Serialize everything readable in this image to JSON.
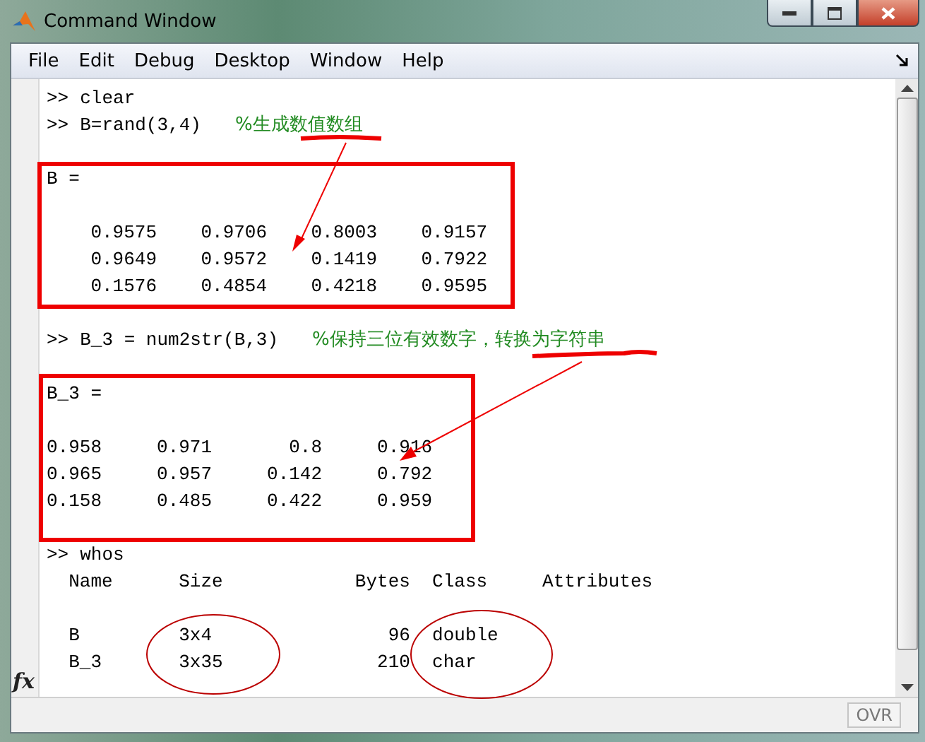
{
  "window": {
    "title": "Command Window"
  },
  "menu": [
    "File",
    "Edit",
    "Debug",
    "Desktop",
    "Window",
    "Help"
  ],
  "console": [
    {
      "kind": "command",
      "prompt": ">>",
      "command": "clear"
    },
    {
      "kind": "command",
      "prompt": ">>",
      "command": "B=rand(3,4)",
      "comment": "%生成数值数组"
    },
    {
      "kind": "blank"
    },
    {
      "kind": "output",
      "text": "B ="
    },
    {
      "kind": "blank"
    },
    {
      "kind": "output",
      "text": "    0.9575    0.9706    0.8003    0.9157"
    },
    {
      "kind": "output",
      "text": "    0.9649    0.9572    0.1419    0.7922"
    },
    {
      "kind": "output",
      "text": "    0.1576    0.4854    0.4218    0.9595"
    },
    {
      "kind": "blank"
    },
    {
      "kind": "command",
      "prompt": ">>",
      "command": "B_3 = num2str(B,3)",
      "comment": "%保持三位有效数字，转换为字符串"
    },
    {
      "kind": "blank"
    },
    {
      "kind": "output",
      "text": "B_3 ="
    },
    {
      "kind": "blank"
    },
    {
      "kind": "output",
      "text": "0.958     0.971       0.8     0.916"
    },
    {
      "kind": "output",
      "text": "0.965     0.957     0.142     0.792"
    },
    {
      "kind": "output",
      "text": "0.158     0.485     0.422     0.959"
    },
    {
      "kind": "blank"
    },
    {
      "kind": "command",
      "prompt": ">>",
      "command": "whos"
    },
    {
      "kind": "output",
      "text": "  Name      Size            Bytes  Class     Attributes"
    },
    {
      "kind": "blank"
    },
    {
      "kind": "output",
      "text": "  B         3x4                96  double"
    },
    {
      "kind": "output",
      "text": "  B_3       3x35              210  char"
    }
  ],
  "function_browser": "fx",
  "status_bar": {
    "mode": "OVR"
  }
}
